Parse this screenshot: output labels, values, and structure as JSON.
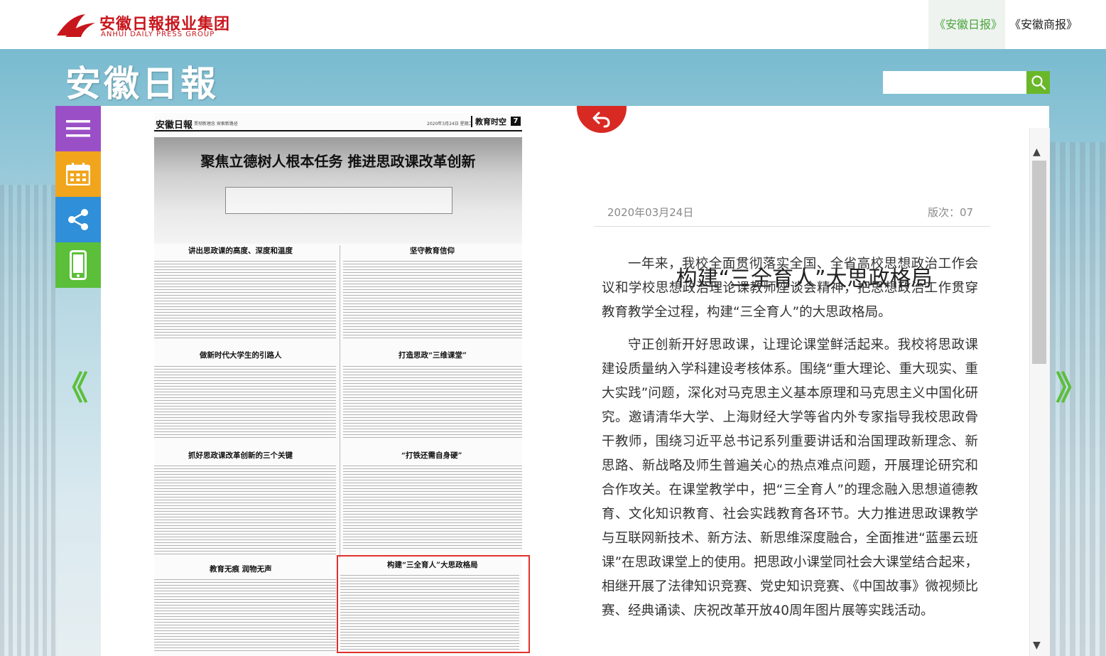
{
  "header": {
    "logo_cn": "安徽日報报业集团",
    "logo_en": "ANHUI DAILY PRESS GROUP",
    "pub_tabs": [
      {
        "label": "《安徽日报》",
        "active": true
      },
      {
        "label": "《安徽商报》",
        "active": false
      }
    ]
  },
  "masthead": {
    "title": "安徽日報",
    "search_placeholder": ""
  },
  "tools": [
    {
      "icon": "menu-icon",
      "color": "#9b4fc7"
    },
    {
      "icon": "calendar-icon",
      "color": "#f0a51c"
    },
    {
      "icon": "share-icon",
      "color": "#2f8fd8"
    },
    {
      "icon": "mobile-icon",
      "color": "#5bbf3a"
    }
  ],
  "nav": {
    "prev": "《",
    "next": "》"
  },
  "paper": {
    "logo": "安徽日報",
    "small_line": "贯彻新理念 探索新路径",
    "date_line": "2020年3月24日 星期二",
    "section": "教育时空",
    "page_number": "7",
    "banner_title": "聚焦立德树人根本任务 推进思政课改革创新",
    "sections": [
      "讲出思政课的高度、深度和温度",
      "坚守教育信仰",
      "做新时代大学生的引路人",
      "打造思政“三维课堂”",
      "抓好思政课改革创新的三个关键",
      "“打铁还需自身硬”",
      "教育无痕 润物无声",
      "构建“三全育人”大思政格局"
    ]
  },
  "article": {
    "title": "构建“三全育人”大思政格局",
    "date": "2020年03月24日",
    "page_label": "版次：07",
    "paragraphs": [
      "一年来，我校全面贯彻落实全国、全省高校思想政治工作会议和学校思想政治理论课教师座谈会精神，把思想政治工作贯穿教育教学全过程，构建“三全育人”的大思政格局。",
      "守正创新开好思政课，让理论课堂鲜活起来。我校将思政课建设质量纳入学科建设考核体系。围绕“重大理论、重大现实、重大实践”问题，深化对马克思主义基本原理和马克思主义中国化研究。邀请清华大学、上海财经大学等省内外专家指导我校思政骨干教师，围绕习近平总书记系列重要讲话和治国理政新理念、新思路、新战略及师生普遍关心的热点难点问题，开展理论研究和合作攻关。在课堂教学中，把“三全育人”的理念融入思想道德教育、文化知识教育、社会实践教育各环节。大力推进思政课教学与互联网新技术、新方法、新思维深度融合，全面推进“蓝墨云班课”在思政课堂上的使用。把思政小课堂同社会大课堂结合起来，相继开展了法律知识竞赛、党史知识竞赛、《中国故事》微视频比赛、经典诵读、庆祝改革开放40周年图片展等实践活动。"
    ]
  },
  "colors": {
    "accent_green": "#5bbf3a",
    "brand_red": "#c8161d",
    "highlight_red": "#e0312b"
  }
}
